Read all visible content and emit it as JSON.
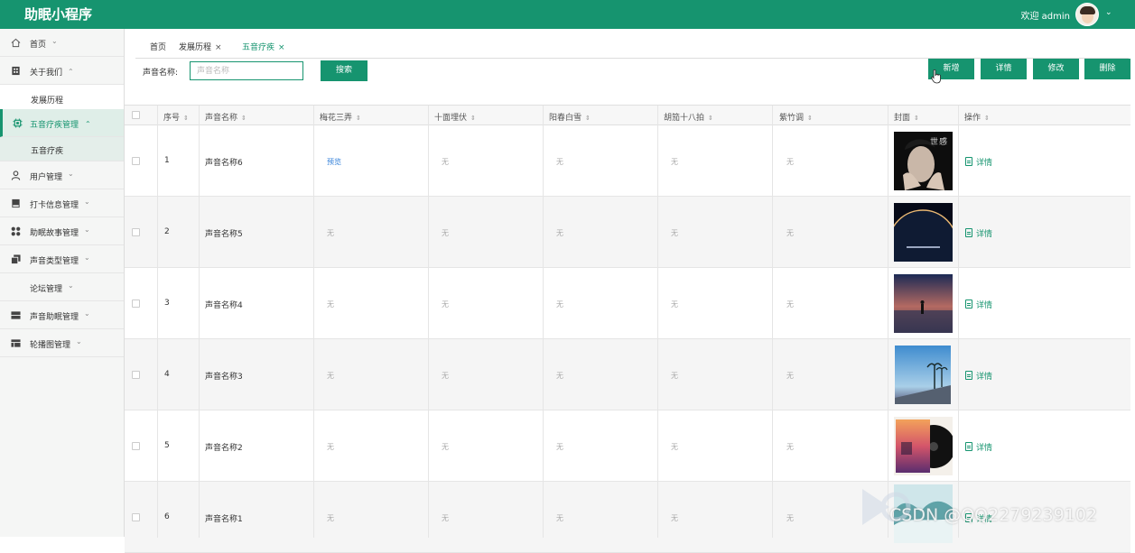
{
  "app": {
    "title": "助眠小程序",
    "welcome": "欢迎 admin"
  },
  "sidebar": {
    "items": [
      {
        "label": "首页",
        "icon": "home-icon"
      },
      {
        "label": "关于我们",
        "icon": "building-icon"
      },
      {
        "label": "发展历程"
      },
      {
        "label": "五音疗疾管理",
        "icon": "chip-icon"
      },
      {
        "label": "五音疗疾"
      },
      {
        "label": "用户管理",
        "icon": "user-icon"
      },
      {
        "label": "打卡信息管理",
        "icon": "bookmark-icon"
      },
      {
        "label": "助眠故事管理",
        "icon": "grid-icon"
      },
      {
        "label": "声音类型管理",
        "icon": "copy-icon"
      },
      {
        "label": "论坛管理"
      },
      {
        "label": "声音助眠管理",
        "icon": "server-icon"
      },
      {
        "label": "轮播图管理",
        "icon": "table-icon"
      }
    ]
  },
  "tabs": [
    {
      "label": "首页"
    },
    {
      "label": "发展历程",
      "close": "×"
    },
    {
      "label": "五音疗疾",
      "close": "×"
    }
  ],
  "search": {
    "label": "声音名称:",
    "placeholder": "声音名称",
    "button": "搜索"
  },
  "toolbar": {
    "add": "新增",
    "detail": "详情",
    "edit": "修改",
    "delete": "删除"
  },
  "table": {
    "columns": [
      "序号",
      "声音名称",
      "梅花三弄",
      "十面埋伏",
      "阳春白雪",
      "胡笳十八拍",
      "紫竹调",
      "封面",
      "操作"
    ],
    "rows": [
      {
        "index": "1",
        "name": "声音名称6",
        "c1": "预览",
        "c2": "无",
        "c3": "无",
        "c4": "无",
        "c5": "无",
        "action": "详情"
      },
      {
        "index": "2",
        "name": "声音名称5",
        "c1": "无",
        "c2": "无",
        "c3": "无",
        "c4": "无",
        "c5": "无",
        "action": "详情"
      },
      {
        "index": "3",
        "name": "声音名称4",
        "c1": "无",
        "c2": "无",
        "c3": "无",
        "c4": "无",
        "c5": "无",
        "action": "详情"
      },
      {
        "index": "4",
        "name": "声音名称3",
        "c1": "无",
        "c2": "无",
        "c3": "无",
        "c4": "无",
        "c5": "无",
        "action": "详情"
      },
      {
        "index": "5",
        "name": "声音名称2",
        "c1": "无",
        "c2": "无",
        "c3": "无",
        "c4": "无",
        "c5": "无",
        "action": "详情"
      },
      {
        "index": "6",
        "name": "声音名称1",
        "c1": "无",
        "c2": "无",
        "c3": "无",
        "c4": "无",
        "c5": "无",
        "action": "详情"
      }
    ]
  },
  "watermark": "CSDN @QQ2279239102",
  "colors": {
    "primary": "#16946f",
    "link": "#2f7ed8"
  }
}
